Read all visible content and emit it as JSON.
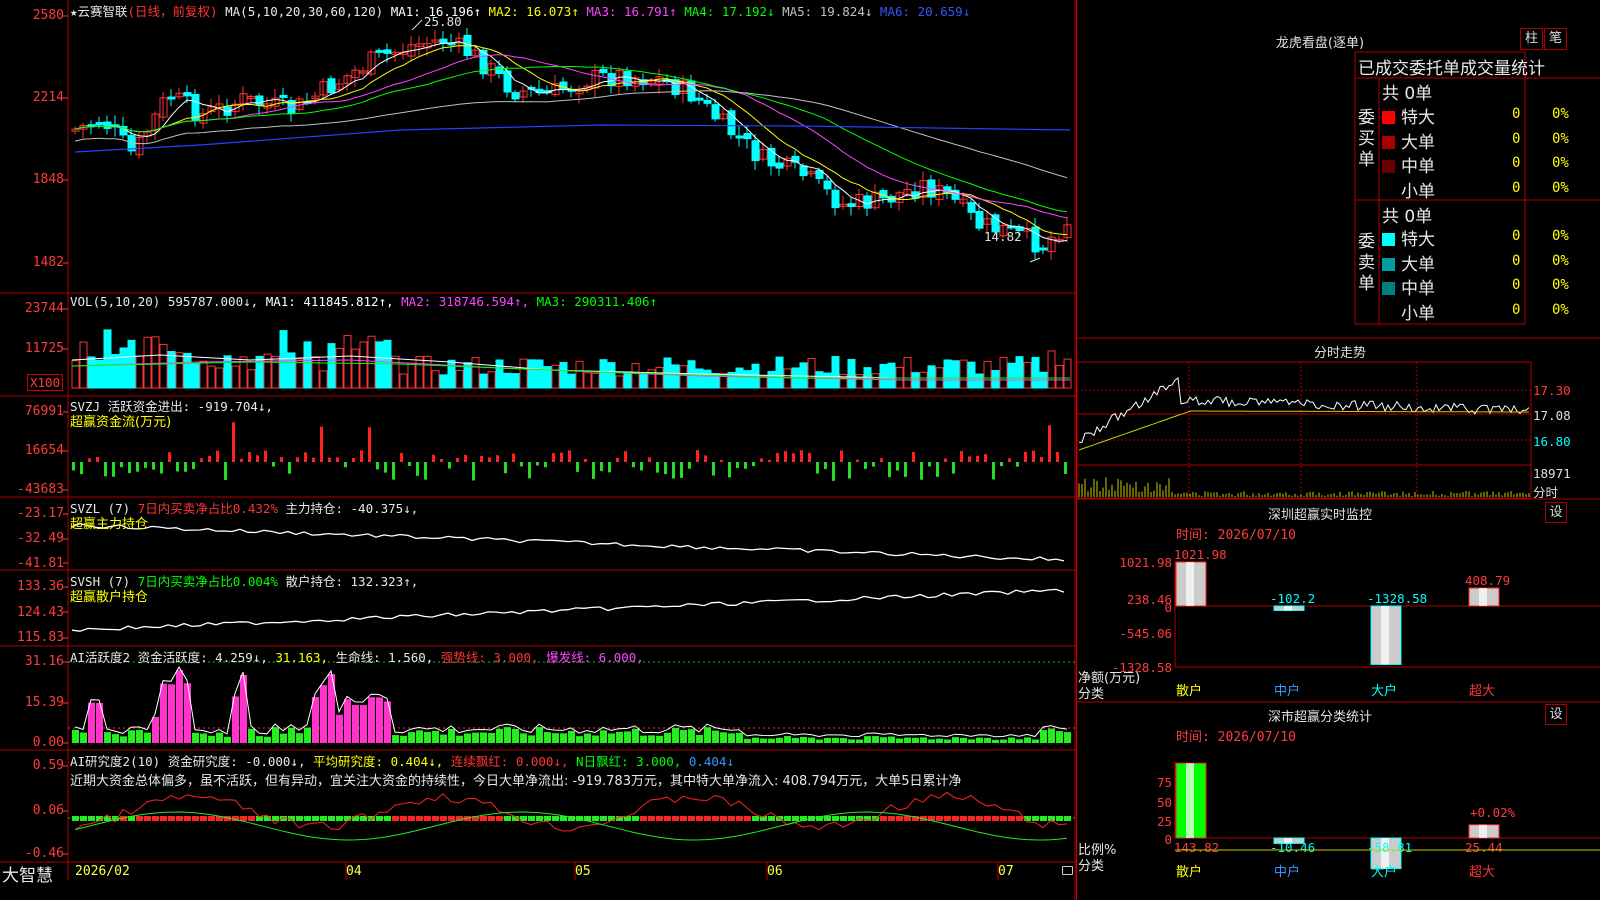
{
  "stock": {
    "name": "★云赛智联",
    "period": "(日线，前复权)"
  },
  "price_panel": {
    "ma_params": "MA(5,10,20,30,60,120)",
    "ma_values": [
      {
        "label": "MA1:",
        "value": "16.196↑",
        "color": "#ffffff"
      },
      {
        "label": "MA2:",
        "value": "16.073↑",
        "color": "#ffff00"
      },
      {
        "label": "MA3:",
        "value": "16.791↑",
        "color": "#ff44ff"
      },
      {
        "label": "MA4:",
        "value": "17.192↓",
        "color": "#00ff00"
      },
      {
        "label": "MA5:",
        "value": "19.824↓",
        "color": "#c0c0c0"
      },
      {
        "label": "MA6:",
        "value": "20.659↓",
        "color": "#3355ff"
      }
    ],
    "high_label": "25.80",
    "low_label": "14.82",
    "y_labels": [
      "2580",
      "2214",
      "1848",
      "1482"
    ]
  },
  "vol_panel": {
    "header": "VOL(5,10,20)",
    "val": "595787.000↓,",
    "ma1": "MA1: 411845.812↑,",
    "ma2": "MA2: 318746.594↑,",
    "ma3": "MA3: 290311.406↑",
    "y_labels": [
      "23744",
      "11725"
    ],
    "unit": "X100"
  },
  "svzj_panel": {
    "header": "SVZJ  活跃资金进出: -919.704↓,",
    "sub": "超赢资金流(万元)",
    "y_labels": [
      "76991",
      "16654",
      "-43683"
    ]
  },
  "svzl_panel": {
    "p1": "SVZL (7)",
    "p2": "7日内买卖净占比0.432%",
    "p3": "主力持仓: -40.375↓,",
    "sub": "超赢主力持仓",
    "y_labels": [
      "-23.17",
      "-32.49",
      "-41.81"
    ]
  },
  "svsh_panel": {
    "p1": "SVSH (7)",
    "p2": "7日内买卖净占比0.004%",
    "p3": "散户持仓: 132.323↑,",
    "sub": "超赢散户持仓",
    "y_labels": [
      "133.36",
      "124.43",
      "115.83"
    ]
  },
  "ai_panel": {
    "p1": "AI活跃度2",
    "p2": "资金活跃度: 4.259↓,",
    "p3": "31.163,",
    "p4": "生命线: 1.560,",
    "p5": "强势线: 3.000,",
    "p6": "爆发线: 6.000,",
    "y_labels": [
      "31.16",
      "15.39",
      "0.00"
    ]
  },
  "research_panel": {
    "p1": "AI研究度2(10)",
    "p2": "资金研究度: -0.000↓,",
    "p3": "平均研究度: 0.404↓,",
    "p4": "连续飘红: 0.000↓,",
    "p5": "N日飘红: 3.000,",
    "p6": "0.404↓",
    "comment": "近期大资金总体偏多，虽不活跃，但有异动，宜关注大资金的持续性，今日大单净流出: -919.783万元，其中特大单净流入: 408.794万元，大单5日累计净",
    "y_labels": [
      "0.59",
      "0.06",
      "-0.46"
    ]
  },
  "x_axis": {
    "brand": "大智慧",
    "dates": [
      "2026/02",
      "04",
      "05",
      "06",
      "07"
    ]
  },
  "dragon_tiger": {
    "title": "龙虎看盘(逐单)",
    "btn_bar": "柱",
    "btn_pen": "笔",
    "table_title": "已成交委托单成交量统计",
    "buy_label": "委买单",
    "sell_label": "委卖单",
    "buy_total": "共 0单",
    "sell_total": "共 0单",
    "buy_rows": [
      {
        "label": "特大",
        "count": "0",
        "pct": "0%",
        "color": "#ff0000"
      },
      {
        "label": "大单",
        "count": "0",
        "pct": "0%",
        "color": "#aa0000"
      },
      {
        "label": "中单",
        "count": "0",
        "pct": "0%",
        "color": "#660000"
      },
      {
        "label": "小单",
        "count": "0",
        "pct": "0%",
        "color": "#000000"
      }
    ],
    "sell_rows": [
      {
        "label": "特大",
        "count": "0",
        "pct": "0%",
        "color": "#00ffff"
      },
      {
        "label": "大单",
        "count": "0",
        "pct": "0%",
        "color": "#00a0a0"
      },
      {
        "label": "中单",
        "count": "0",
        "pct": "0%",
        "color": "#008080"
      },
      {
        "label": "小单",
        "count": "0",
        "pct": "0%",
        "color": "#000000"
      }
    ]
  },
  "intraday": {
    "title": "分时走势",
    "y_labels": [
      "17.30",
      "17.08",
      "16.80",
      "18971"
    ],
    "vol_unit": "分时"
  },
  "sz_monitor": {
    "title": "深圳超赢实时监控",
    "settings": "设",
    "time": "时间: 2026/07/10",
    "y_labels": [
      "1021.98",
      "238.46",
      "0",
      "-545.06",
      "-1328.58"
    ],
    "unit_label": "净额(万元)",
    "cat_label": "分类",
    "chart_data": {
      "type": "bar",
      "categories": [
        "散户",
        "中户",
        "大户",
        "超大"
      ],
      "values": [
        1021.98,
        -102.2,
        -1328.58,
        408.79
      ],
      "value_labels": [
        "1021.98",
        "-102.2",
        "-1328.58",
        "408.79"
      ]
    }
  },
  "sh_stats": {
    "title": "深市超赢分类统计",
    "settings": "设",
    "time": "时间: 2026/07/10",
    "y_labels": [
      "75",
      "50",
      "25",
      "0"
    ],
    "unit_label": "比例%",
    "cat_label": "分类",
    "pct_label": "+0.02%",
    "chart_data": {
      "type": "bar",
      "categories": [
        "散户",
        "中户",
        "大户",
        "超大"
      ],
      "values": [
        143.82,
        -10.46,
        -58.81,
        25.44
      ],
      "value_labels": [
        "143.82",
        "-10.46",
        "-58.81",
        "25.44"
      ]
    }
  }
}
